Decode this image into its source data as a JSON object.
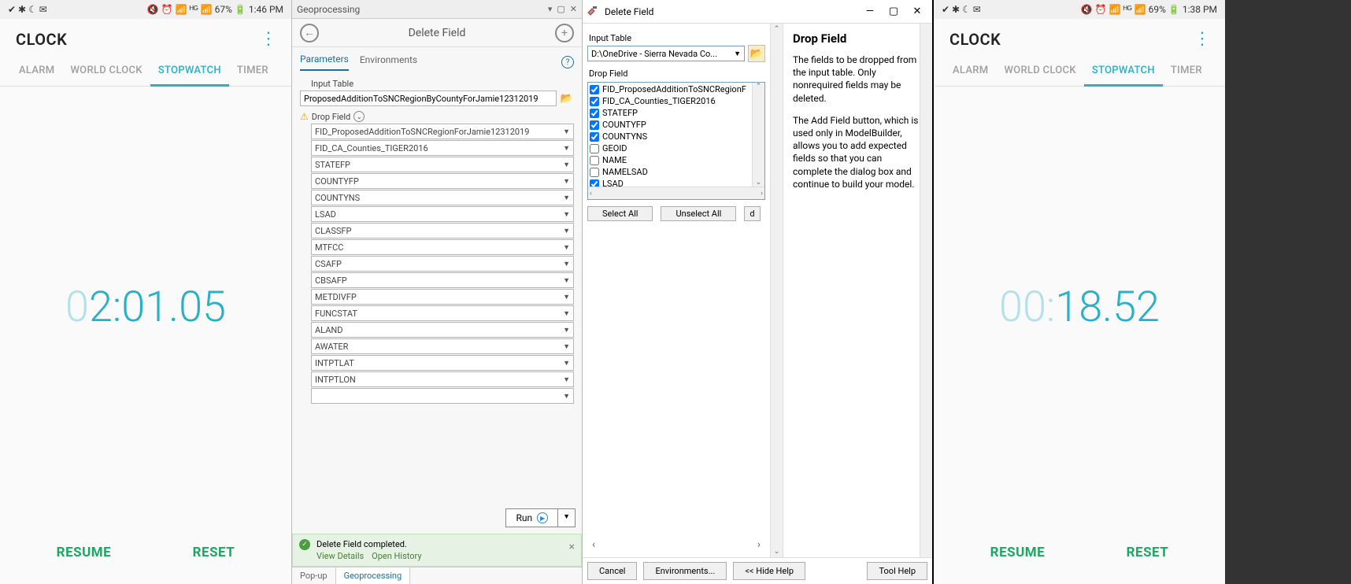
{
  "phone1": {
    "status_left_icons": "✔ ✱ ☾ ✉",
    "status_right": "🔇 ⏰ 📶 ᴴᴳ 📶 67% 🔋 1:46 PM",
    "title": "CLOCK",
    "tabs": {
      "alarm": "ALARM",
      "world": "WORLD CLOCK",
      "stopwatch": "STOPWATCH",
      "timer": "TIMER"
    },
    "time_prefix": "0",
    "time_main": "2:01.05",
    "resume": "RESUME",
    "reset": "RESET"
  },
  "arcpro": {
    "pane_title": "Geoprocessing",
    "tool_title": "Delete Field",
    "tab_params": "Parameters",
    "tab_env": "Environments",
    "input_label": "Input Table",
    "input_value": "ProposedAdditionToSNCRegionByCountyForJamie12312019",
    "dropfield_label": "Drop Field",
    "fields": [
      "FID_ProposedAdditionToSNCRegionForJamie12312019",
      "FID_CA_Counties_TIGER2016",
      "STATEFP",
      "COUNTYFP",
      "COUNTYNS",
      "LSAD",
      "CLASSFP",
      "MTFCC",
      "CSAFP",
      "CBSAFP",
      "METDIVFP",
      "FUNCSTAT",
      "ALAND",
      "AWATER",
      "INTPTLAT",
      "INTPTLON",
      ""
    ],
    "run": "Run",
    "status_title": "Delete Field completed.",
    "status_link1": "View Details",
    "status_link2": "Open History",
    "bottom_tab1": "Pop-up",
    "bottom_tab2": "Geoprocessing"
  },
  "arcmap": {
    "title": "Delete Field",
    "left": {
      "input_label": "Input Table",
      "input_value": "D:\\OneDrive - Sierra Nevada Co...",
      "dropfield_label": "Drop Field",
      "checks": [
        {
          "label": "FID_ProposedAdditionToSNCRegionF",
          "checked": true
        },
        {
          "label": "FID_CA_Counties_TIGER2016",
          "checked": true
        },
        {
          "label": "STATEFP",
          "checked": true
        },
        {
          "label": "COUNTYFP",
          "checked": true
        },
        {
          "label": "COUNTYNS",
          "checked": true
        },
        {
          "label": "GEOID",
          "checked": false
        },
        {
          "label": "NAME",
          "checked": false
        },
        {
          "label": "NAMELSAD",
          "checked": false
        },
        {
          "label": "LSAD",
          "checked": true
        }
      ],
      "select_all": "Select All",
      "unselect_all": "Unselect All",
      "d": "d"
    },
    "help": {
      "title": "Drop Field",
      "p1": "The fields to be dropped from the input table. Only nonrequired fields may be deleted.",
      "p2": "The Add Field button, which is used only in ModelBuilder, allows you to add expected fields so that you can complete the dialog box and continue to build your model."
    },
    "footer": {
      "cancel": "Cancel",
      "env": "Environments...",
      "hide": "<< Hide Help",
      "toolhelp": "Tool Help"
    }
  },
  "phone2": {
    "status_left_icons": "✔ ✱ ☾ ✉",
    "status_right": "🔇 ⏰ 📶 ᴴᴳ 📶 69% 🔋 1:38 PM",
    "title": "CLOCK",
    "tabs": {
      "alarm": "ALARM",
      "world": "WORLD CLOCK",
      "stopwatch": "STOPWATCH",
      "timer": "TIMER"
    },
    "time_prefix": "00:",
    "time_main": "18.52",
    "resume": "RESUME",
    "reset": "RESET"
  }
}
